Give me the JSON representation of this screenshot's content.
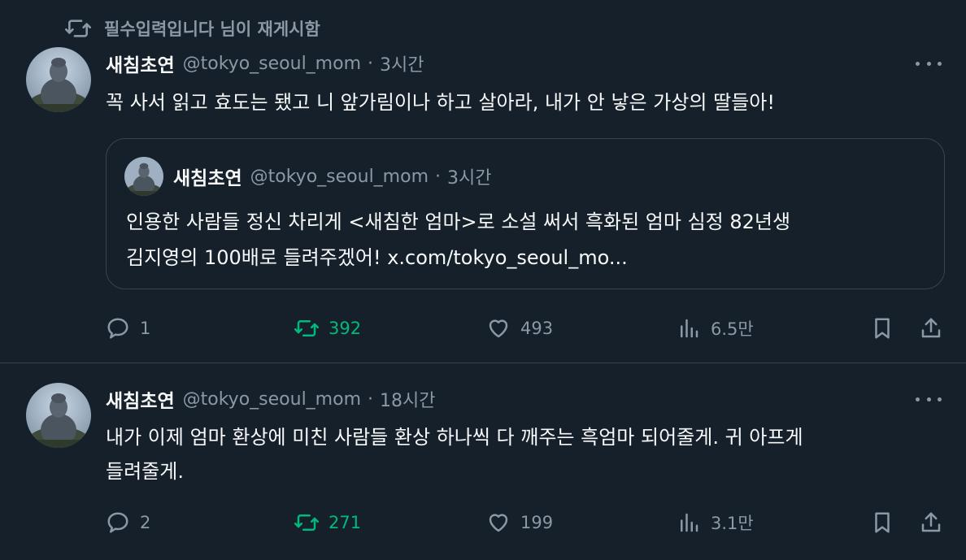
{
  "colors": {
    "background": "#15202b",
    "divider": "#38444d",
    "secondary_text": "#8b98a5",
    "primary_text": "#f7f9f9",
    "retweet_green": "#00ba7c"
  },
  "tweets": [
    {
      "retweet_banner": "필수입력입니다 님이 재게시함",
      "author": {
        "name": "새침초연",
        "handle": "@tokyo_seoul_mom"
      },
      "separator": "·",
      "time": "3시간",
      "text": "꼭 사서 읽고 효도는 됐고 니 앞가림이나 하고 살아라, 내가 안 낳은 가상의 딸들아!",
      "quote": {
        "author": {
          "name": "새침초연",
          "handle": "@tokyo_seoul_mom"
        },
        "separator": "·",
        "time": "3시간",
        "line1": "인용한 사람들 정신 차리게 <새침한 엄마>로 소설 써서 흑화된 엄마 심정 82년생",
        "line2": "김지영의 100배로 들려주겠어! x.com/tokyo_seoul_mo..."
      },
      "stats": {
        "replies": "1",
        "reposts": "392",
        "likes": "493",
        "views": "6.5만"
      },
      "reposted_by_viewer": true
    },
    {
      "author": {
        "name": "새침초연",
        "handle": "@tokyo_seoul_mom"
      },
      "separator": "·",
      "time": "18시간",
      "text_line1": "내가 이제 엄마 환상에 미친 사람들 환상 하나씩 다 깨주는 흑엄마 되어줄게. 귀 아프게",
      "text_line2": "들려줄게.",
      "stats": {
        "replies": "2",
        "reposts": "271",
        "likes": "199",
        "views": "3.1만"
      },
      "reposted_by_viewer": true
    }
  ],
  "icons": {
    "retweet": "retweet-icon",
    "reply": "reply-icon",
    "like": "heart-icon",
    "views": "views-icon",
    "bookmark": "bookmark-icon",
    "share": "share-icon",
    "more": "more-icon",
    "avatar": "buddha-statue-avatar"
  }
}
